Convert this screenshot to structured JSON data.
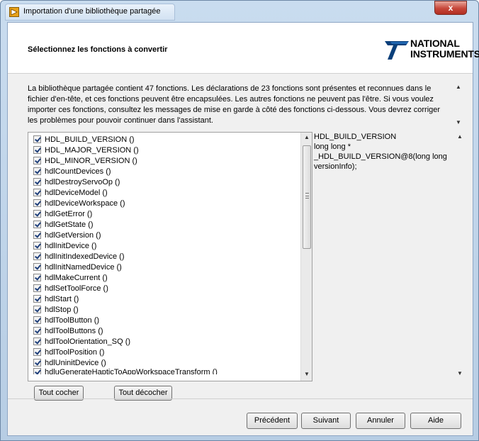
{
  "window": {
    "title": "Importation d'une bibliothèque partagée",
    "close_label": "x"
  },
  "header": {
    "heading": "Sélectionnez les fonctions à convertir",
    "logo_line1": "NATIONAL",
    "logo_line2": "INSTRUMENTS"
  },
  "intro": "La bibliothèque partagée contient 47 fonctions. Les déclarations de 23 fonctions sont présentes et reconnues dans le fichier d'en-tête, et ces fonctions peuvent être encapsulées. Les autres fonctions ne peuvent pas l'être. Si vous voulez importer ces fonctions, consultez les messages de mise en garde à côté des fonctions ci-dessous. Vous devrez corriger les problèmes pour pouvoir continuer dans l'assistant.",
  "functions": [
    {
      "label": "HDL_BUILD_VERSION ()",
      "checked": true
    },
    {
      "label": "HDL_MAJOR_VERSION ()",
      "checked": true
    },
    {
      "label": "HDL_MINOR_VERSION ()",
      "checked": true
    },
    {
      "label": "hdlCountDevices ()",
      "checked": true
    },
    {
      "label": "hdlDestroyServoOp ()",
      "checked": true
    },
    {
      "label": "hdlDeviceModel ()",
      "checked": true
    },
    {
      "label": "hdlDeviceWorkspace ()",
      "checked": true
    },
    {
      "label": "hdlGetError ()",
      "checked": true
    },
    {
      "label": "hdlGetState ()",
      "checked": true
    },
    {
      "label": "hdlGetVersion ()",
      "checked": true
    },
    {
      "label": "hdlInitDevice ()",
      "checked": true
    },
    {
      "label": "hdlInitIndexedDevice ()",
      "checked": true
    },
    {
      "label": "hdlInitNamedDevice ()",
      "checked": true
    },
    {
      "label": "hdlMakeCurrent ()",
      "checked": true
    },
    {
      "label": "hdlSetToolForce ()",
      "checked": true
    },
    {
      "label": "hdlStart ()",
      "checked": true
    },
    {
      "label": "hdlStop ()",
      "checked": true
    },
    {
      "label": "hdlToolButton ()",
      "checked": true
    },
    {
      "label": "hdlToolButtons ()",
      "checked": true
    },
    {
      "label": "hdlToolOrientation_SQ ()",
      "checked": true
    },
    {
      "label": "hdlToolPosition ()",
      "checked": true
    },
    {
      "label": "hdlUninitDevice ()",
      "checked": true
    },
    {
      "label": "hdluGenerateHapticToAppWorkspaceTransform ()",
      "checked": true
    }
  ],
  "details": {
    "name": "HDL_BUILD_VERSION",
    "signature": "long long * _HDL_BUILD_VERSION@8(long long versionInfo);"
  },
  "buttons": {
    "check_all": "Tout cocher",
    "uncheck_all": "Tout décocher",
    "previous": "Précédent",
    "next": "Suivant",
    "cancel": "Annuler",
    "help": "Aide"
  }
}
